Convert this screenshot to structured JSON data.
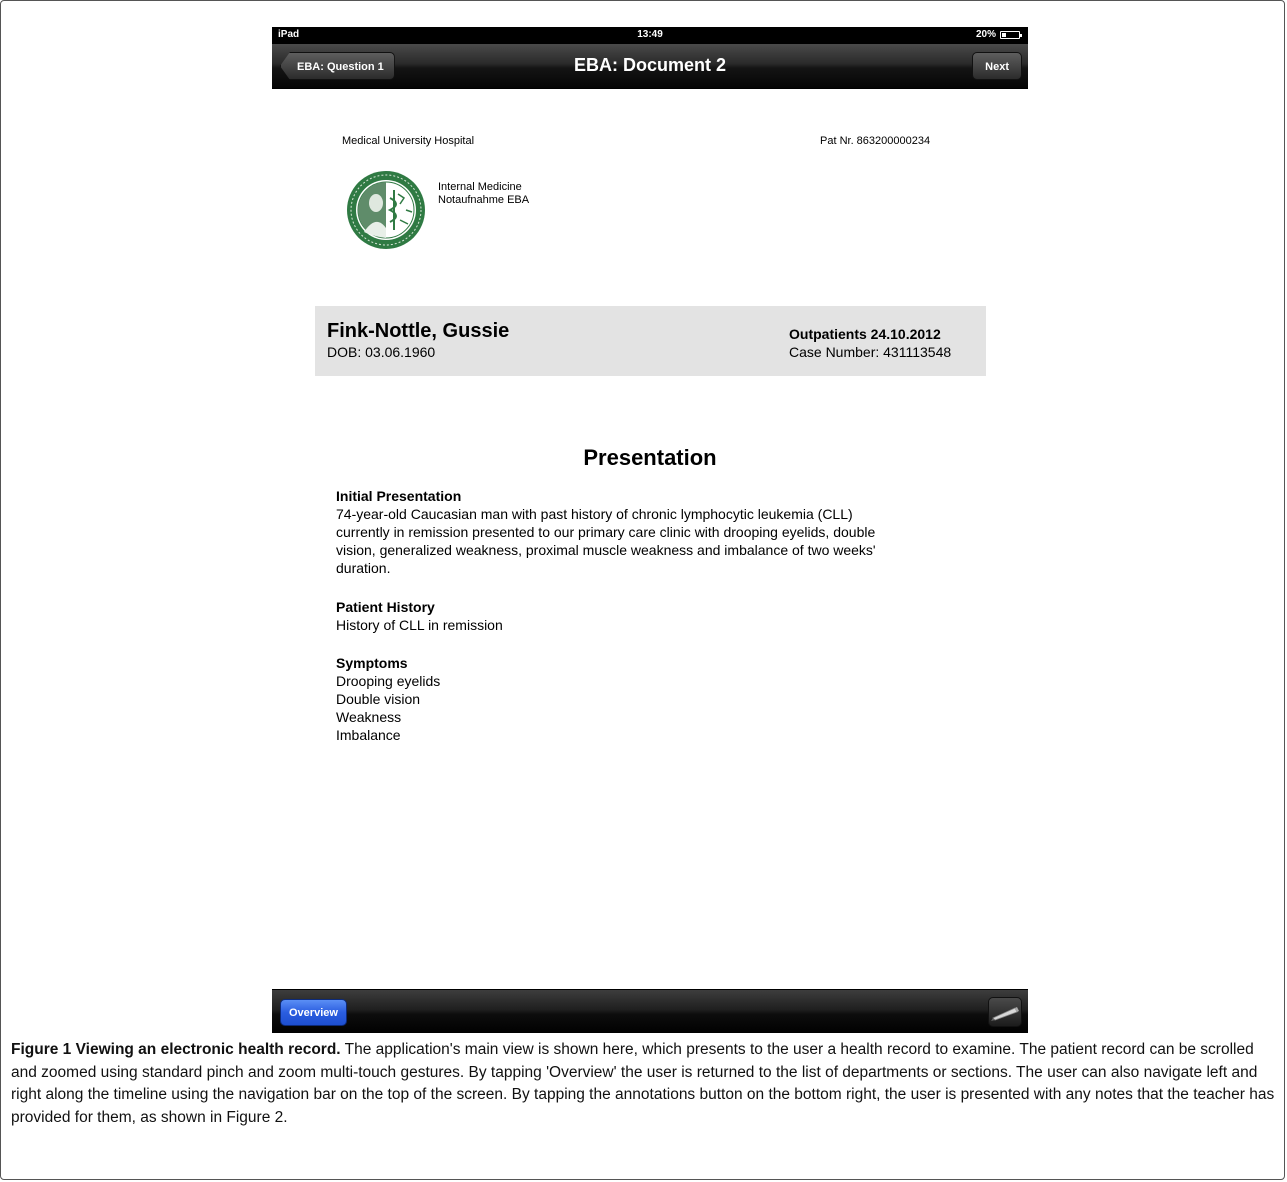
{
  "statusbar": {
    "carrier": "iPad",
    "time": "13:49",
    "battery": "20%"
  },
  "navbar": {
    "back_label": "EBA: Question 1",
    "title": "EBA: Document 2",
    "next_label": "Next"
  },
  "document": {
    "hospital": "Medical University Hospital",
    "pat_nr": "Pat Nr. 863200000234",
    "department_line1": "Internal Medicine",
    "department_line2": "Notaufnahme EBA",
    "patient": {
      "name": "Fink-Nottle, Gussie",
      "dob": "DOB: 03.06.1960",
      "visit": "Outpatients 24.10.2012",
      "case_number": "Case Number: 431113548"
    },
    "presentation_title": "Presentation",
    "sections": [
      {
        "heading": "Initial Presentation",
        "lines": [
          "74-year-old Caucasian man with past history of chronic lymphocytic leukemia (CLL)",
          "currently in remission presented to our primary care clinic with drooping eyelids, double",
          "vision, generalized weakness, proximal muscle weakness and imbalance of two weeks'",
          "duration."
        ]
      },
      {
        "heading": "Patient History",
        "lines": [
          "History of CLL in remission"
        ]
      },
      {
        "heading": "Symptoms",
        "lines": [
          "Drooping eyelids",
          "Double vision",
          "Weakness",
          "Imbalance"
        ]
      }
    ]
  },
  "toolbar": {
    "overview_label": "Overview",
    "annotations_icon": "pencil-icon"
  },
  "caption": {
    "label": "Figure 1 Viewing an electronic health record.",
    "text": "The application's main view is shown here, which presents to the user a health record to examine. The patient record can be scrolled and zoomed using standard pinch and zoom multi-touch gestures. By tapping 'Overview' the user is returned to the list of departments or sections. The user can also navigate left and right along the timeline using the navigation bar on the top of the screen. By tapping the annotations button on the bottom right, the user is presented with any notes that the teacher has provided for them, as shown in Figure 2."
  },
  "colors": {
    "toolbar": "#0d0d0d",
    "overview_blue": "#2a5de0",
    "patient_box": "#e3e3e3"
  }
}
